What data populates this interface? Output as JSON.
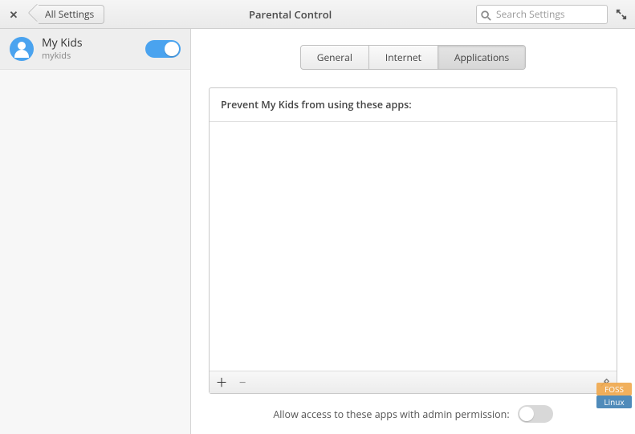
{
  "header": {
    "back_label": "All Settings",
    "title": "Parental Control",
    "search_placeholder": "Search Settings"
  },
  "sidebar": {
    "user": {
      "display_name": "My Kids",
      "login_name": "mykids",
      "toggle_on": true
    }
  },
  "main": {
    "tabs": [
      {
        "id": "general",
        "label": "General",
        "active": false
      },
      {
        "id": "internet",
        "label": "Internet",
        "active": false
      },
      {
        "id": "applications",
        "label": "Applications",
        "active": true
      }
    ],
    "apps_panel": {
      "header": "Prevent My Kids from using these apps:",
      "items": []
    },
    "admin_toggle": {
      "label": "Allow access to these apps with admin permission:",
      "on": false
    }
  },
  "watermark": {
    "line1": "FOSS",
    "line2": "Linux"
  }
}
